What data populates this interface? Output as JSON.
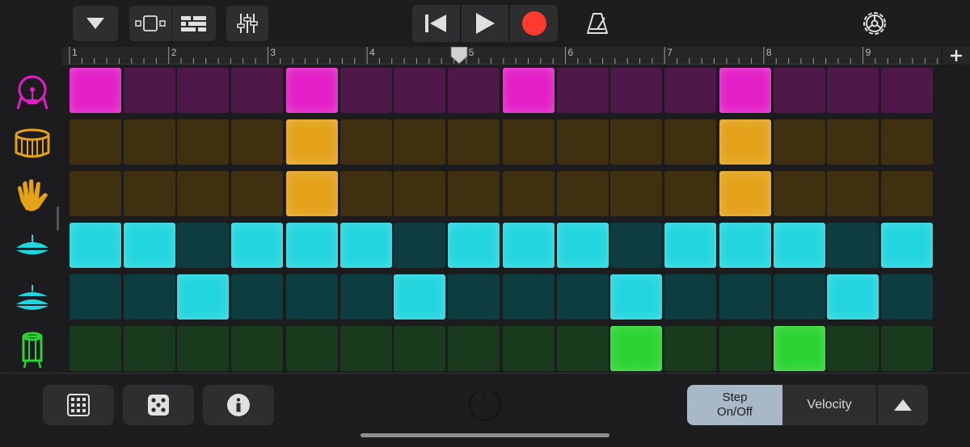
{
  "toolbar": {
    "icons": [
      "chevron-down-icon",
      "track-view-icon",
      "step-sequencer-icon",
      "mixer-icon",
      "go-to-beginning-icon",
      "play-icon",
      "record-icon",
      "metronome-icon",
      "settings-icon"
    ],
    "record_color": "#ff3b30"
  },
  "ruler": {
    "bar_numbers": [
      "1",
      "2",
      "3",
      "4",
      "5",
      "6",
      "7",
      "8",
      "9"
    ],
    "playhead_bar": "5"
  },
  "tracks": [
    {
      "name": "kick-drum",
      "icon": "kick-drum-icon",
      "color": "#e21fc6",
      "dim": "#4e1848",
      "steps": [
        1,
        0,
        0,
        0,
        1,
        0,
        0,
        0,
        1,
        0,
        0,
        0,
        1,
        0,
        0,
        0
      ]
    },
    {
      "name": "snare-drum",
      "icon": "snare-drum-icon",
      "color": "#e3a21a",
      "dim": "#3f300f",
      "steps": [
        0,
        0,
        0,
        0,
        1,
        0,
        0,
        0,
        0,
        0,
        0,
        0,
        1,
        0,
        0,
        0
      ]
    },
    {
      "name": "clap",
      "icon": "hand-clap-icon",
      "color": "#e3a21a",
      "dim": "#3f300f",
      "steps": [
        0,
        0,
        0,
        0,
        1,
        0,
        0,
        0,
        0,
        0,
        0,
        0,
        1,
        0,
        0,
        0
      ]
    },
    {
      "name": "closed-hihat",
      "icon": "closed-hihat-icon",
      "color": "#23d5de",
      "dim": "#0d3d40",
      "steps": [
        1,
        1,
        0,
        1,
        1,
        1,
        0,
        1,
        1,
        1,
        0,
        1,
        1,
        1,
        0,
        1
      ]
    },
    {
      "name": "open-hihat",
      "icon": "open-hihat-icon",
      "color": "#23d5de",
      "dim": "#0d3d40",
      "steps": [
        0,
        0,
        1,
        0,
        0,
        0,
        1,
        0,
        0,
        0,
        1,
        0,
        0,
        0,
        1,
        0
      ]
    },
    {
      "name": "percussion",
      "icon": "percussion-drum-icon",
      "color": "#2bd432",
      "dim": "#1a3a1e",
      "steps": [
        0,
        0,
        0,
        0,
        0,
        0,
        0,
        0,
        0,
        0,
        1,
        0,
        0,
        1,
        0,
        0
      ]
    }
  ],
  "bottom": {
    "icons": [
      "pattern-grid-icon",
      "dice-icon",
      "info-icon",
      "power-icon",
      "chevron-up-icon"
    ],
    "step_label_line1": "Step",
    "step_label_line2": "On/Off",
    "velocity_label": "Velocity",
    "active_mode": "Step On/Off"
  }
}
